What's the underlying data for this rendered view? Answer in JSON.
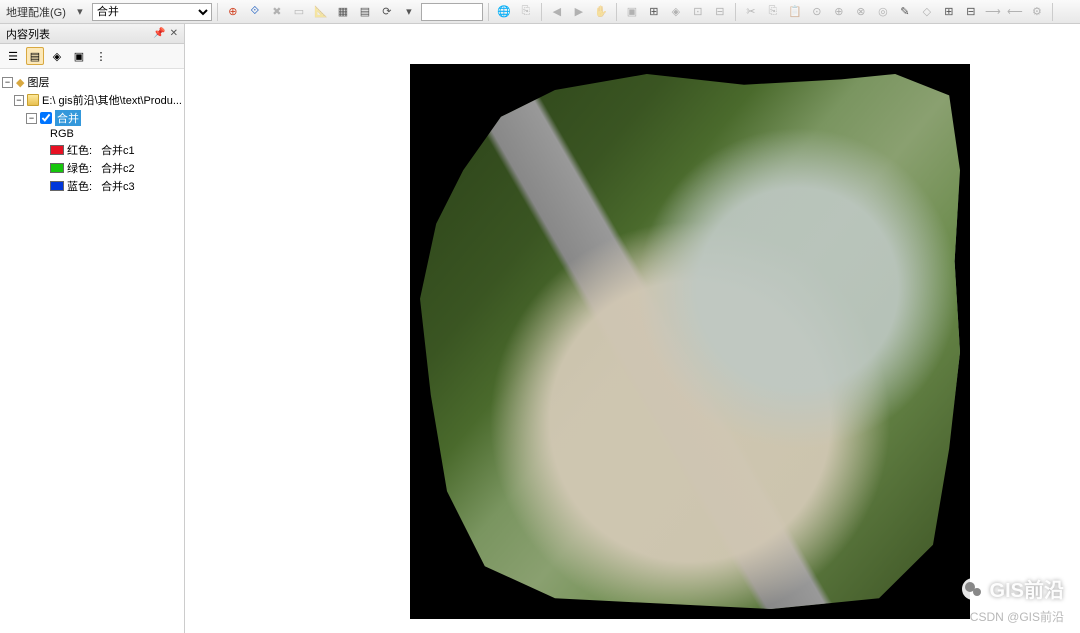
{
  "toolbar": {
    "georeference_label": "地理配准(G)",
    "layer_select": "合并",
    "search_value": ""
  },
  "toc": {
    "title": "内容列表",
    "root_label": "图层",
    "dataframe_path": "E:\\        gis前沿\\其他\\text\\Produ...",
    "active_layer": "合并",
    "composite": "RGB",
    "bands": [
      {
        "color": "red",
        "label": "红色:",
        "value": "合并c1"
      },
      {
        "color": "green",
        "label": "绿色:",
        "value": "合并c2"
      },
      {
        "color": "blue",
        "label": "蓝色:",
        "value": "合并c3"
      }
    ]
  },
  "watermark": {
    "wechat": "GIS前沿",
    "csdn": "CSDN @GIS前沿"
  },
  "icons": {
    "add_cp": "✚",
    "link": "⟐",
    "rotate": "↻",
    "measure": "📏",
    "table": "▦",
    "view": "👁",
    "refresh": "⟳",
    "arrow_l": "◀",
    "arrow_r": "▶",
    "pan": "✋",
    "globe": "🌐",
    "zoom_in": "🔍",
    "select": "▭",
    "edit1": "✎",
    "edit2": "⊞",
    "cut": "✂",
    "target": "⊕"
  }
}
